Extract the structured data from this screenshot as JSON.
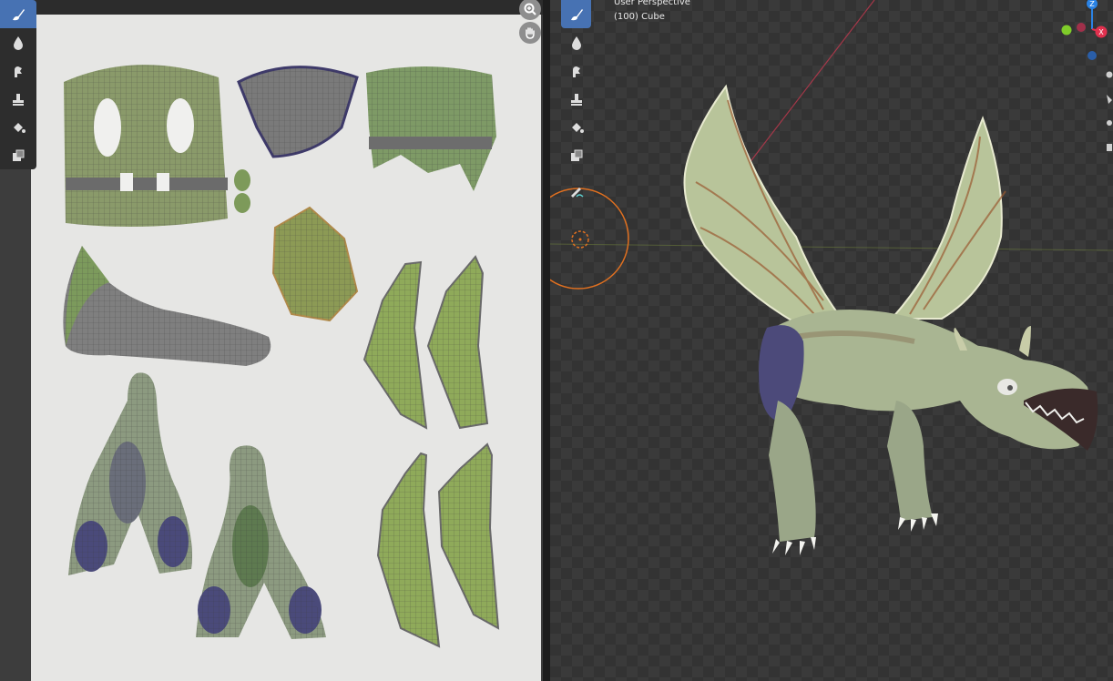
{
  "viewport": {
    "perspective_label": "User Perspective",
    "object_label": "(100) Cube",
    "gizmo_axes": {
      "z": "Z",
      "x": "X"
    },
    "colors": {
      "accent_blue": "#4772b3",
      "axis_x": "#e0304e",
      "axis_y": "#7fcc2a",
      "axis_z": "#2a82e4",
      "cursor": "#e07020"
    }
  },
  "image_editor": {
    "tools": [
      "brush-icon",
      "blur-icon",
      "smear-icon",
      "clone-icon",
      "fill-icon",
      "mask-icon"
    ],
    "nav": [
      "zoom-icon",
      "pan-hand-icon"
    ]
  },
  "viewport_tools": [
    "brush-icon",
    "blur-icon",
    "smear-icon",
    "clone-icon",
    "fill-icon",
    "mask-icon",
    "annotate-icon"
  ]
}
